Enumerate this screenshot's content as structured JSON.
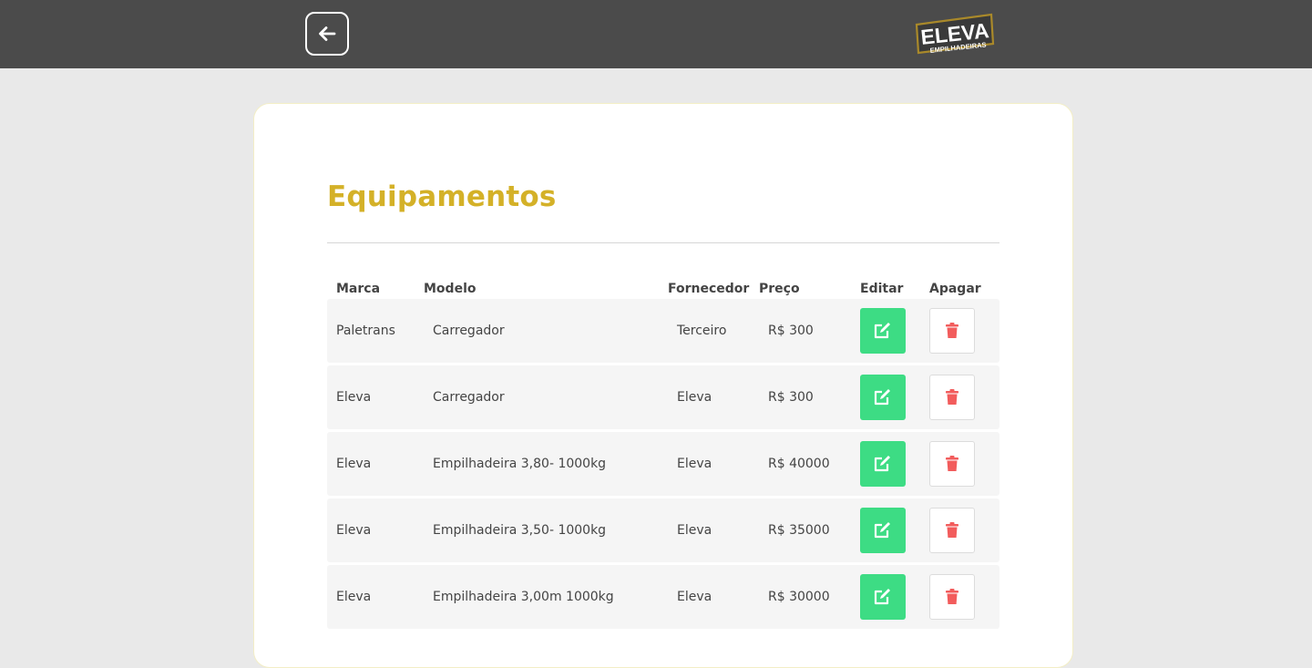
{
  "header": {
    "back_icon": "arrow-left-icon",
    "logo": {
      "text": "ELEVA",
      "subtext": "EMPILHADEIRAS",
      "border_color": "#a9892a"
    }
  },
  "main": {
    "title": "Equipamentos",
    "accent_color": "#d4b128",
    "table": {
      "headers": {
        "brand": "Marca",
        "model": "Modelo",
        "supplier": "Fornecedor",
        "price": "Preço",
        "edit": "Editar",
        "delete": "Apagar"
      },
      "rows": [
        {
          "brand": "Paletrans",
          "model": "Carregador",
          "supplier": "Terceiro",
          "price": "R$ 300"
        },
        {
          "brand": "Eleva",
          "model": "Carregador",
          "supplier": "Eleva",
          "price": "R$ 300"
        },
        {
          "brand": "Eleva",
          "model": "Empilhadeira 3,80- 1000kg",
          "supplier": "Eleva",
          "price": "R$ 40000"
        },
        {
          "brand": "Eleva",
          "model": "Empilhadeira 3,50- 1000kg",
          "supplier": "Eleva",
          "price": "R$ 35000"
        },
        {
          "brand": "Eleva",
          "model": "Empilhadeira 3,00m 1000kg",
          "supplier": "Eleva",
          "price": "R$ 30000"
        }
      ],
      "edit_icon": "edit-icon",
      "delete_icon": "trash-icon",
      "edit_color": "#3ddc84",
      "delete_color": "#f25c5c"
    }
  }
}
